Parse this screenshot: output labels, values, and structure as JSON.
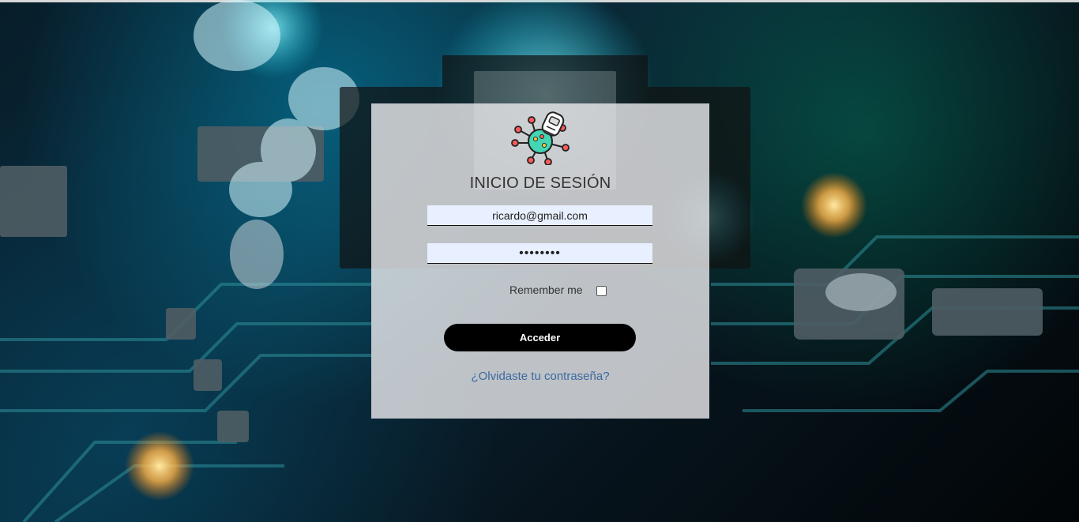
{
  "login": {
    "title": "INICIO DE SESIÓN",
    "email_value": "ricardo@gmail.com",
    "password_value": "••••••••",
    "remember_label": "Remember me",
    "remember_checked": false,
    "submit_label": "Acceder",
    "forgot_password_text": "¿Olvidaste tu contraseña?"
  },
  "colors": {
    "card_background": "#ececef",
    "input_background": "#e8f0ff",
    "button_background": "#000000",
    "link": "#3b6aa0"
  },
  "icons": {
    "logo": "robot-circuit-logo"
  }
}
